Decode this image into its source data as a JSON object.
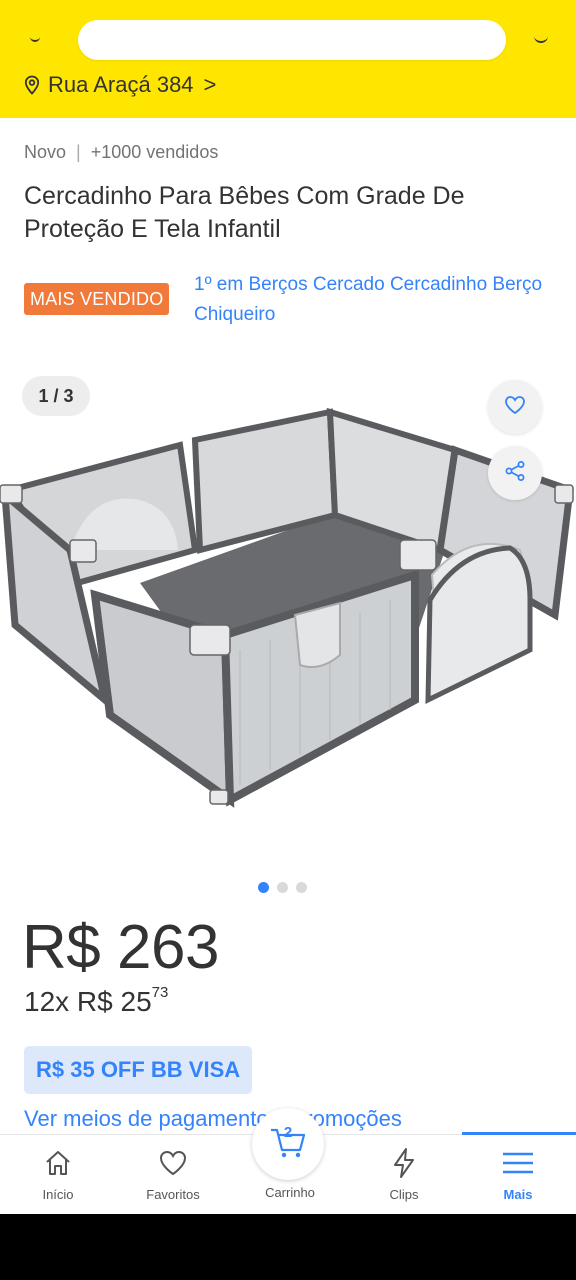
{
  "header": {
    "address": "Rua Araçá 384",
    "address_chevron": ">",
    "colors": {
      "background": "#ffe600"
    },
    "icons": [
      "back-icon",
      "location-pin-icon",
      "chevron-right-icon",
      "cart-icon"
    ]
  },
  "product": {
    "condition": "Novo",
    "separator": "|",
    "sold": "+1000 vendidos",
    "title": "Cercadinho Para Bêbes Com Grade De Proteção E Tela Infantil",
    "badge": "MAIS VENDIDO",
    "badge_color": "#f17a3a",
    "rank_link": "1º em Berços Cercado Cercadinho Berço Chiqueiro"
  },
  "gallery": {
    "counter": "1 / 3",
    "total_images": 3,
    "active_index": 1,
    "icons": [
      "heart-icon",
      "share-icon"
    ]
  },
  "price": {
    "main": "R$ 263",
    "installments_prefix": "12x R$ 25",
    "installments_cents": "73",
    "promo": "R$ 35 OFF BB VISA",
    "payment_link": "Ver meios de pagamento e promoções"
  },
  "nav": {
    "home": "Início",
    "favorites": "Favoritos",
    "cart": "Carrinho",
    "cart_count": "2",
    "clips": "Clips",
    "more": "Mais",
    "accent": "#3483fa"
  }
}
